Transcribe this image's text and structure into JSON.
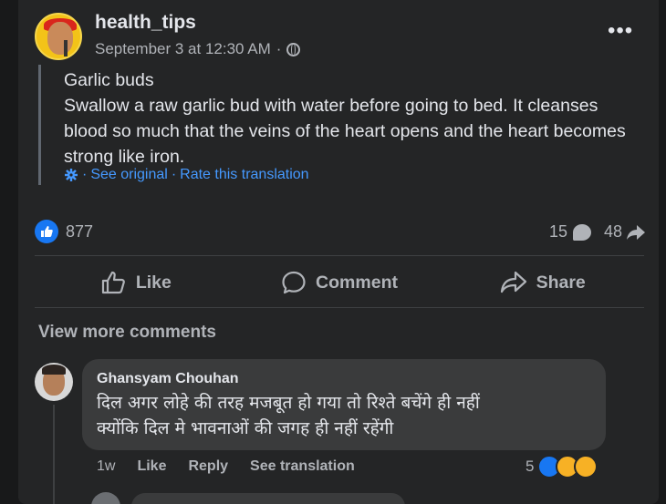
{
  "post": {
    "author": "health_tips",
    "timestamp": "September 3 at 12:30 AM",
    "separator": "·",
    "more_label": "•••",
    "text_lines": [
      "Garlic buds",
      "Swallow a raw garlic bud with water before going to bed. It cleanses blood so much that the veins of the heart opens and the heart becomes strong like iron."
    ],
    "translation": {
      "see_original": "See original",
      "rate": "Rate this translation",
      "dot1": "·",
      "dot2": "·"
    }
  },
  "stats": {
    "reactions": "877",
    "comments": "15",
    "shares": "48"
  },
  "actions": {
    "like": "Like",
    "comment": "Comment",
    "share": "Share"
  },
  "comments_section": {
    "view_more": "View more comments",
    "items": [
      {
        "author": "Ghansyam Chouhan",
        "text_line1": "दिल अगर लोहे की तरह मजबूत हो गया तो रिश्ते बचेंगे ही नहीं",
        "text_line2": "क्योंकि दिल मे भावनाओं की जगह ही नहीं रहेंगी",
        "time": "1w",
        "like": "Like",
        "reply": "Reply",
        "see_translation": "See translation",
        "reaction_count": "5"
      }
    ]
  },
  "colors": {
    "background": "#18191a",
    "card": "#242526",
    "accent": "#1877f2",
    "link": "#4599ff"
  }
}
